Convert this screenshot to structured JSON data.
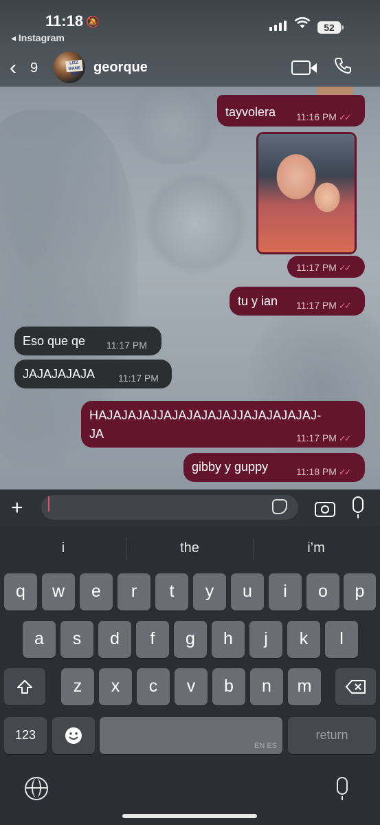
{
  "status_bar": {
    "time": "11:18",
    "back_app": "◂ Instagram",
    "battery": "52"
  },
  "header": {
    "back_count": "9",
    "contact_name": "georque",
    "avatar_sign_text": "LIZZ MANE 2026"
  },
  "messages": [
    {
      "direction": "out",
      "text": "tayvolera",
      "time": "11:16 PM"
    },
    {
      "direction": "out",
      "type": "photo",
      "time": "11:17 PM"
    },
    {
      "direction": "out",
      "text": "tu y ian",
      "time": "11:17 PM"
    },
    {
      "direction": "in",
      "text": "Eso que qe",
      "time": "11:17 PM"
    },
    {
      "direction": "in",
      "text": "JAJAJAJAJA",
      "time": "11:17 PM"
    },
    {
      "direction": "out",
      "text_line1": "HAJAJAJAJJAJAJAJAJAJJAJAJAJAJAJ-",
      "text_line2": "JA",
      "time": "11:17 PM"
    },
    {
      "direction": "out",
      "text": "gibby y guppy",
      "time": "11:18 PM"
    }
  ],
  "composer": {
    "input_value": ""
  },
  "keyboard": {
    "suggestions": [
      "i",
      "the",
      "i’m"
    ],
    "row1": [
      "q",
      "w",
      "e",
      "r",
      "t",
      "y",
      "u",
      "i",
      "o",
      "p"
    ],
    "row2": [
      "a",
      "s",
      "d",
      "f",
      "g",
      "h",
      "j",
      "k",
      "l"
    ],
    "row3": [
      "z",
      "x",
      "c",
      "v",
      "b",
      "n",
      "m"
    ],
    "numbers_label": "123",
    "space_lang": "EN ES",
    "return_label": "return"
  },
  "colors": {
    "outgoing_bubble": "#64152d",
    "incoming_bubble": "#2c2f32",
    "read_ticks": "#e06a87"
  }
}
